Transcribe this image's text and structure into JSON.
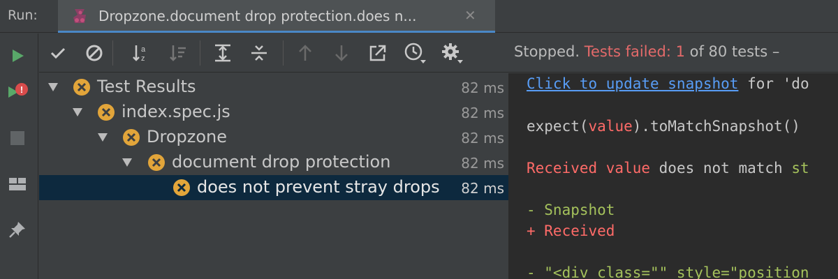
{
  "header": {
    "run_label": "Run:",
    "tab_title": "Dropzone.document drop protection.does n...",
    "tab_close": "✕"
  },
  "toolbar": {
    "status_prefix": "Stopped.",
    "status_failed": "Tests failed: 1",
    "status_suffix": "of 80 tests –"
  },
  "tree": [
    {
      "label": "Test Results",
      "duration": "82 ms",
      "selected": false
    },
    {
      "label": "index.spec.js",
      "duration": "82 ms",
      "selected": false
    },
    {
      "label": "Dropzone",
      "duration": "82 ms",
      "selected": false
    },
    {
      "label": "document drop protection",
      "duration": "82 ms",
      "selected": false
    },
    {
      "label": "does not prevent stray drops",
      "duration": "82 ms",
      "selected": true
    }
  ],
  "console": {
    "link": "Click to update snapshot",
    "link_suffix": " for 'do",
    "expect_prefix": "expect(",
    "expect_value": "value",
    "expect_suffix": ").toMatchSnapshot()",
    "received_value": "Received value",
    "received_mid": " does not match ",
    "received_tail": "st",
    "minus_snapshot": "- Snapshot",
    "plus_received": "+ Received",
    "diff_line": "- \"<div class=\"\" style=\"position"
  },
  "colors": {
    "accent": "#4a88c7",
    "fail": "#e36a6a",
    "run_green": "#59a869",
    "warning_icon": "#e2a53a",
    "selection": "#0d293e"
  }
}
